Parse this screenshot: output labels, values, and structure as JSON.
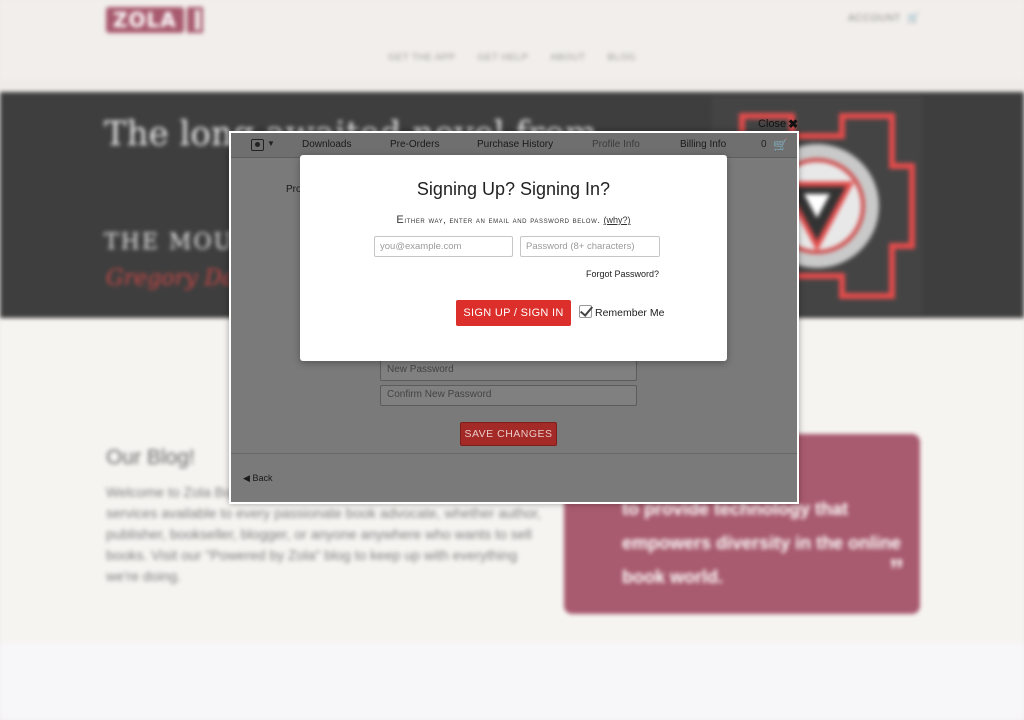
{
  "site": {
    "logo_text": "ZOLA",
    "account_label": "ACCOUNT",
    "nav": [
      "GET THE APP",
      "GET HELP",
      "ABOUT",
      "BLOG"
    ],
    "hero": {
      "title": "The long awaited novel from",
      "subtitle": "THE MOUN",
      "author": "Gregory Day"
    },
    "blog": {
      "title": "Our Blog!",
      "text": "Welcome to Zola Books, a bookselling technology company making its services available to every passionate book advocate, whether author, publisher, bookseller, blogger, or anyone anywhere who wants to sell books. Visit our \"Powered by Zola\" blog to keep up with everything we're doing."
    },
    "mission": {
      "text": "to provide technology that empowers diversity in the online book world.",
      "quote_mark": "”"
    }
  },
  "account_window": {
    "close_label": "Close",
    "tabs": [
      "Downloads",
      "Pre-Orders",
      "Purchase History",
      "Profile Info",
      "Billing Info"
    ],
    "active_tab": "Profile Info",
    "cart_count": "0",
    "profile_label": "Pro",
    "new_password_placeholder": "New Password",
    "confirm_password_placeholder": "Confirm New Password",
    "save_label": "SAVE CHANGES",
    "back_label": "Back"
  },
  "modal": {
    "title": "Signing Up? Signing In?",
    "subtitle_lead": "E",
    "subtitle_rest": "ither way, enter an email and password below.",
    "why_label": "(why?)",
    "email_placeholder": "you@example.com",
    "password_placeholder": "Password (8+ characters)",
    "forgot_label": "Forgot Password?",
    "submit_label": "SIGN UP / SIGN IN",
    "remember_label": "Remember Me",
    "remember_checked": true
  },
  "colors": {
    "brand": "#a85a6e",
    "submit": "#dc2f2b",
    "overlay_panel": "#7a7a7a"
  }
}
